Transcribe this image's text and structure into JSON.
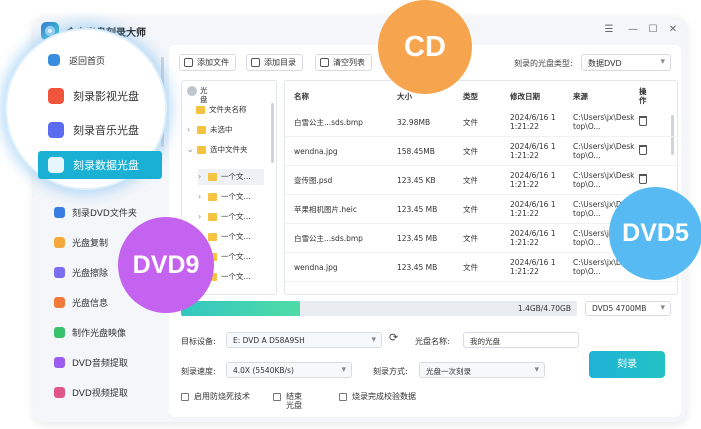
{
  "app": {
    "title": "金舟光盘刻录大师"
  },
  "sidebar": {
    "back_home": "返回首页",
    "items": [
      {
        "label": "刻录影视光盘",
        "color": "#f0553b"
      },
      {
        "label": "刻录音乐光盘",
        "color": "#5b6cf0"
      },
      {
        "label": "刻录数据光盘",
        "color": "#1ab0d4"
      },
      {
        "label": "刻录DVD文件夹",
        "color": "#3a7de0"
      },
      {
        "label": "光盘复制",
        "color": "#f3a93b"
      },
      {
        "label": "光盘擦除",
        "color": "#7b6df0"
      },
      {
        "label": "光盘信息",
        "color": "#f07a3b"
      },
      {
        "label": "制作光盘映像",
        "color": "#38c26e"
      },
      {
        "label": "DVD音频提取",
        "color": "#9b5df0"
      },
      {
        "label": "DVD视频提取",
        "color": "#e0558a"
      }
    ],
    "active": "刻录数据光盘"
  },
  "toolbar": {
    "add_file": "添加文件",
    "add_dir": "添加目录",
    "clear_list": "清空列表",
    "disc_type_label": "刻录的光盘类型:",
    "disc_type_value": "数据DVD"
  },
  "tree": {
    "root": "光盘",
    "nodes": [
      "文件夹名称",
      "未选中",
      "选中文件夹"
    ],
    "children": [
      "一个文...",
      "一个文...",
      "一个文...",
      "一个文...",
      "一个文...",
      "一个文..."
    ]
  },
  "table": {
    "headers": [
      "名称",
      "大小",
      "类型",
      "修改日期",
      "来源",
      "操作"
    ],
    "rows": [
      {
        "name": "白雪公主...sds.bmp",
        "size": "32.98MB",
        "type": "文件",
        "date": "2024/6/16 11:21:22",
        "source": "C:\\Users\\jx\\Desktop\\O..."
      },
      {
        "name": "wendna.jpg",
        "size": "158.45MB",
        "type": "文件",
        "date": "2024/6/16 11:21:22",
        "source": "C:\\Users\\jx\\Desktop\\O..."
      },
      {
        "name": "壹传图.psd",
        "size": "123.45 KB",
        "type": "文件",
        "date": "2024/6/16 11:21:22",
        "source": "C:\\Users\\jx\\Desktop\\O..."
      },
      {
        "name": "苹果相机图片.heic",
        "size": "123.45 MB",
        "type": "文件",
        "date": "2024/6/16 11:21:22",
        "source": "C:\\Users\\jx\\Desktop\\O..."
      },
      {
        "name": "白雪公主...sds.bmp",
        "size": "123.45 MB",
        "type": "文件",
        "date": "2024/6/16 11:21:22",
        "source": "C:\\Users\\jx\\Desktop\\O..."
      },
      {
        "name": "wendna.jpg",
        "size": "123.45 MB",
        "type": "文件",
        "date": "2024/6/16 11:21:22",
        "source": "C:\\Users\\jx\\Desktop\\O..."
      }
    ]
  },
  "capacity": {
    "text": "1.4GB/4.70GB",
    "fraction": 0.3,
    "disc": "DVD5 4700MB"
  },
  "form": {
    "device_label": "目标设备:",
    "device_value": "E:  DVD A DS8A9SH",
    "disc_name_label": "光盘名称:",
    "disc_name_value": "我的光盘",
    "speed_label": "刻录速度:",
    "speed_value": "4.0X  (5540KB/s)",
    "mode_label": "刻录方式:",
    "mode_value": "光盘一次刻录",
    "check_prevent": "启用防烧死技术",
    "check_finish": "结束光盘",
    "check_verify": "烧录完成校验数据",
    "burn_button": "刻录"
  },
  "badges": {
    "cd": "CD",
    "dvd5": "DVD5",
    "dvd9": "DVD9"
  }
}
